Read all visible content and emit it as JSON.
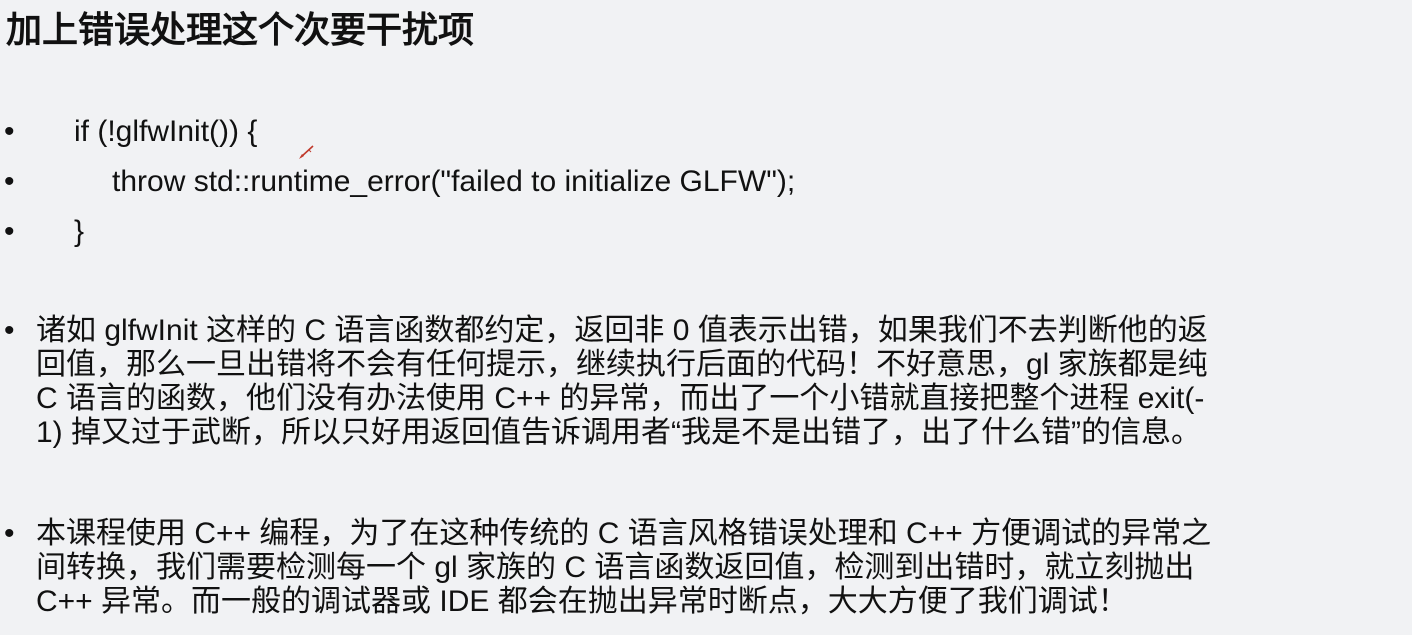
{
  "title": "加上错误处理这个次要干扰项",
  "code": {
    "bullet": "•",
    "lines": [
      "if (!glfwInit()) {",
      "throw std::runtime_error(\"failed to initialize GLFW\");",
      "}"
    ]
  },
  "paragraphs": [
    {
      "bullet": "•",
      "text": "诸如 glfwInit 这样的 C 语言函数都约定，返回非 0 值表示出错，如果我们不去判断他的返\n回值，那么一旦出错将不会有任何提示，继续执行后面的代码！不好意思，gl 家族都是纯\nC 语言的函数，他们没有办法使用 C++ 的异常，而出了一个小错就直接把整个进程 exit(-\n1) 掉又过于武断，所以只好用返回值告诉调用者“我是不是出错了，出了什么错”的信息。"
    },
    {
      "bullet": "•",
      "text": "本课程使用 C++ 编程，为了在这种传统的 C 语言风格错误处理和 C++ 方便调试的异常之\n间转换，我们需要检测每一个 gl 家族的 C 语言函数返回值，检测到出错时，就立刻抛出\nC++ 异常。而一般的调试器或 IDE 都会在抛出异常时断点，大大方便了我们调试！"
    }
  ],
  "icons": {
    "cursor": "pen-cursor-icon"
  },
  "colors": {
    "background": "#f1f2f4",
    "text": "#111111",
    "pen": "#c0392b"
  }
}
